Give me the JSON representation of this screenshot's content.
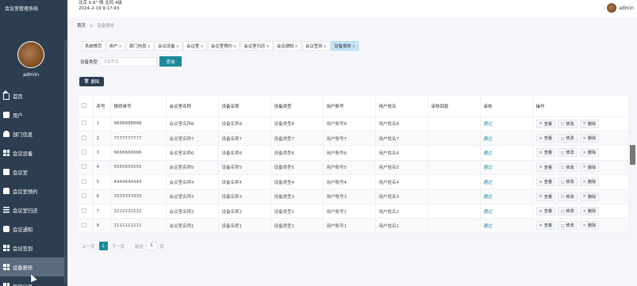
{
  "app": {
    "title": "会议室管理系统"
  },
  "weather": {
    "line1": "北京  0.8°  晴  北风  4级",
    "line2": "2024-2-19 9:17:43"
  },
  "user": {
    "name": "admin"
  },
  "sidebar": {
    "avatar_name": "admin",
    "items": [
      {
        "label": "首页",
        "icon": "home-icon"
      },
      {
        "label": "用户",
        "icon": "briefcase-icon"
      },
      {
        "label": "部门信息",
        "icon": "user-icon"
      },
      {
        "label": "会议设备",
        "icon": "grid-icon"
      },
      {
        "label": "会议室",
        "icon": "clipboard-icon"
      },
      {
        "label": "会议室预约",
        "icon": "speaker-icon"
      },
      {
        "label": "会议室归还",
        "icon": "stack-icon"
      },
      {
        "label": "会议通知",
        "icon": "chat-icon"
      },
      {
        "label": "会议签到",
        "icon": "grid-icon"
      },
      {
        "label": "设备报修",
        "icon": "grid-icon"
      },
      {
        "label": "报修记录",
        "icon": "grid-icon"
      }
    ],
    "active_index": 9
  },
  "breadcrumb": {
    "home": "首页",
    "sep": "≡",
    "current": "设备报修"
  },
  "tabs": [
    {
      "label": "系统首页",
      "closable": false
    },
    {
      "label": "用户",
      "closable": true
    },
    {
      "label": "部门信息",
      "closable": true
    },
    {
      "label": "会议设备",
      "closable": true
    },
    {
      "label": "会议室",
      "closable": true
    },
    {
      "label": "会议室预约",
      "closable": true
    },
    {
      "label": "会议室归还",
      "closable": true
    },
    {
      "label": "会议通知",
      "closable": true
    },
    {
      "label": "会议签到",
      "closable": true
    },
    {
      "label": "设备报修",
      "closable": true
    }
  ],
  "tab_close": "×",
  "search": {
    "label": "设备类型",
    "placeholder": "设备类型",
    "button": "查询"
  },
  "toolbar": {
    "delete_label": "删除",
    "delete_icon": "🗑"
  },
  "table": {
    "headers": [
      "序号",
      "报修单号",
      "会议室名称",
      "设备名称",
      "设备类型",
      "用户账号",
      "用户姓名",
      "审核回复",
      "审核",
      "操作"
    ],
    "rows": [
      {
        "index": "1",
        "code": "8888888888",
        "room": "会议室名称8",
        "device": "设备名称8",
        "type": "设备类型8",
        "account": "用户账号8",
        "name": "用户姓名8",
        "reply": "",
        "status": "通过"
      },
      {
        "index": "2",
        "code": "7777777777",
        "room": "会议室名称7",
        "device": "设备名称7",
        "type": "设备类型7",
        "account": "用户账号7",
        "name": "用户姓名7",
        "reply": "",
        "status": "通过"
      },
      {
        "index": "3",
        "code": "6666666666",
        "room": "会议室名称6",
        "device": "设备名称6",
        "type": "设备类型6",
        "account": "用户账号6",
        "name": "用户姓名6",
        "reply": "",
        "status": "通过"
      },
      {
        "index": "4",
        "code": "5555555555",
        "room": "会议室名称5",
        "device": "设备名称5",
        "type": "设备类型5",
        "account": "用户账号5",
        "name": "用户姓名5",
        "reply": "",
        "status": "通过"
      },
      {
        "index": "5",
        "code": "4444444444",
        "room": "会议室名称4",
        "device": "设备名称4",
        "type": "设备类型4",
        "account": "用户账号4",
        "name": "用户姓名4",
        "reply": "",
        "status": "通过"
      },
      {
        "index": "6",
        "code": "3333333333",
        "room": "会议室名称3",
        "device": "设备名称3",
        "type": "设备类型3",
        "account": "用户账号3",
        "name": "用户姓名3",
        "reply": "",
        "status": "通过"
      },
      {
        "index": "7",
        "code": "2222222222",
        "room": "会议室名称2",
        "device": "设备名称2",
        "type": "设备类型2",
        "account": "用户账号2",
        "name": "用户姓名2",
        "reply": "",
        "status": "通过"
      },
      {
        "index": "8",
        "code": "1111111111",
        "room": "会议室名称1",
        "device": "设备名称1",
        "type": "设备类型1",
        "account": "用户账号1",
        "name": "用户姓名1",
        "reply": "",
        "status": "通过"
      }
    ],
    "actions": [
      {
        "label": "查看",
        "icon": "≡",
        "name": "view"
      },
      {
        "label": "修改",
        "icon": "◻",
        "name": "edit"
      },
      {
        "label": "删除",
        "icon": "✕",
        "name": "delete"
      }
    ]
  },
  "pager": {
    "prev": "上一页",
    "current": "1",
    "next": "下一页",
    "goto": "前往",
    "page_input": "1",
    "page_suffix": "页"
  }
}
